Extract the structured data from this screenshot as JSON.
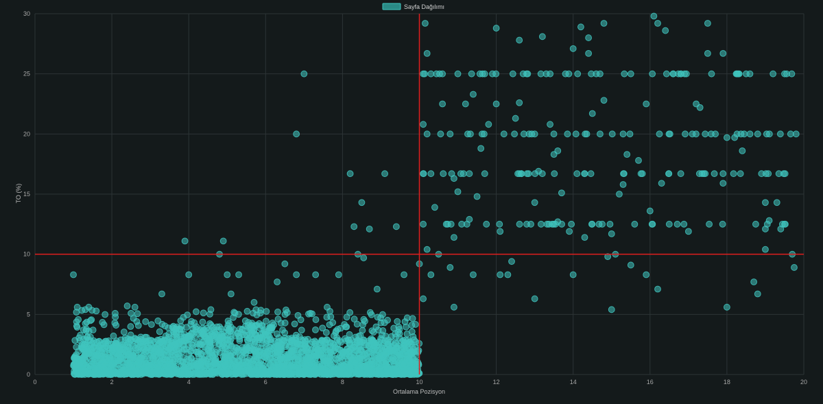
{
  "chart_data": {
    "type": "scatter",
    "title": "",
    "legend": {
      "position": "top-center",
      "label": "Sayfa Dağılımı",
      "color": "#2a8a86"
    },
    "xlabel": "Ortalama Pozisyon",
    "ylabel": "TO (%)",
    "xlim": [
      0,
      20
    ],
    "ylim": [
      0,
      30
    ],
    "x_ticks": [
      0,
      2,
      4,
      6,
      8,
      10,
      12,
      14,
      16,
      18,
      20
    ],
    "y_ticks": [
      0,
      5,
      10,
      15,
      20,
      25,
      30
    ],
    "grid": true,
    "reference_lines": {
      "x": 10,
      "y": 10,
      "color": "#e01e1e"
    },
    "point_color": "#40c4be",
    "series": [
      {
        "name": "Sayfa Dağılımı",
        "points": [
          [
            1.0,
            8.3
          ],
          [
            1.1,
            5.6
          ],
          [
            1.4,
            5.6
          ],
          [
            2.4,
            5.7
          ],
          [
            2.6,
            5.6
          ],
          [
            3.3,
            6.7
          ],
          [
            3.9,
            11.1
          ],
          [
            4.0,
            8.3
          ],
          [
            4.8,
            10.0
          ],
          [
            4.9,
            11.1
          ],
          [
            5.0,
            8.3
          ],
          [
            5.1,
            6.7
          ],
          [
            5.3,
            8.3
          ],
          [
            5.7,
            6.0
          ],
          [
            6.3,
            7.7
          ],
          [
            6.5,
            9.2
          ],
          [
            6.8,
            20.0
          ],
          [
            6.8,
            8.3
          ],
          [
            7.0,
            25.0
          ],
          [
            7.3,
            8.3
          ],
          [
            7.6,
            5.6
          ],
          [
            7.9,
            8.3
          ],
          [
            8.2,
            16.7
          ],
          [
            8.3,
            12.3
          ],
          [
            8.4,
            10.0
          ],
          [
            8.5,
            14.3
          ],
          [
            8.55,
            9.7
          ],
          [
            8.7,
            12.1
          ],
          [
            8.9,
            7.1
          ],
          [
            9.1,
            16.7
          ],
          [
            9.4,
            12.3
          ],
          [
            9.6,
            8.3
          ],
          [
            10.0,
            9.2
          ],
          [
            9.0,
            4.3
          ],
          [
            9.8,
            4.1
          ],
          [
            10.15,
            29.2
          ],
          [
            10.2,
            26.7
          ],
          [
            10.3,
            25.0
          ],
          [
            10.1,
            25.0
          ],
          [
            10.1,
            20.8
          ],
          [
            10.2,
            20.0
          ],
          [
            10.1,
            16.7
          ],
          [
            10.3,
            16.7
          ],
          [
            10.1,
            12.5
          ],
          [
            10.4,
            13.9
          ],
          [
            10.2,
            10.4
          ],
          [
            10.3,
            8.3
          ],
          [
            10.1,
            6.3
          ],
          [
            10.5,
            10.0
          ],
          [
            10.6,
            22.5
          ],
          [
            10.6,
            25.0
          ],
          [
            10.8,
            20.0
          ],
          [
            10.9,
            16.3
          ],
          [
            10.7,
            12.5
          ],
          [
            10.9,
            11.4
          ],
          [
            10.8,
            8.9
          ],
          [
            10.9,
            5.6
          ],
          [
            11.0,
            15.2
          ],
          [
            11.0,
            25.0
          ],
          [
            11.2,
            22.5
          ],
          [
            11.3,
            16.7
          ],
          [
            11.3,
            12.9
          ],
          [
            11.4,
            23.3
          ],
          [
            11.5,
            14.8
          ],
          [
            11.4,
            8.3
          ],
          [
            11.6,
            18.8
          ],
          [
            11.8,
            20.8
          ],
          [
            11.9,
            25.0
          ],
          [
            12.0,
            28.8
          ],
          [
            12.0,
            22.5
          ],
          [
            12.1,
            11.9
          ],
          [
            12.1,
            8.3
          ],
          [
            12.3,
            8.3
          ],
          [
            12.4,
            9.4
          ],
          [
            12.5,
            21.3
          ],
          [
            12.6,
            22.6
          ],
          [
            12.6,
            27.8
          ],
          [
            12.7,
            25.0
          ],
          [
            12.9,
            12.5
          ],
          [
            13.0,
            14.3
          ],
          [
            13.0,
            6.3
          ],
          [
            13.1,
            16.9
          ],
          [
            13.2,
            28.1
          ],
          [
            13.4,
            20.8
          ],
          [
            13.5,
            18.3
          ],
          [
            13.6,
            18.6
          ],
          [
            13.6,
            12.7
          ],
          [
            13.7,
            15.1
          ],
          [
            13.9,
            11.9
          ],
          [
            14.0,
            27.1
          ],
          [
            14.1,
            16.7
          ],
          [
            14.2,
            28.9
          ],
          [
            14.3,
            11.4
          ],
          [
            14.4,
            26.7
          ],
          [
            14.4,
            28.0
          ],
          [
            14.5,
            21.7
          ],
          [
            14.6,
            25.0
          ],
          [
            14.7,
            20.0
          ],
          [
            14.8,
            29.2
          ],
          [
            14.8,
            22.8
          ],
          [
            14.9,
            9.8
          ],
          [
            15.0,
            11.7
          ],
          [
            15.0,
            5.4
          ],
          [
            15.2,
            15.0
          ],
          [
            15.3,
            15.8
          ],
          [
            15.4,
            18.3
          ],
          [
            15.5,
            9.1
          ],
          [
            15.6,
            12.5
          ],
          [
            15.7,
            17.8
          ],
          [
            15.8,
            16.7
          ],
          [
            15.9,
            8.3
          ],
          [
            15.9,
            22.5
          ],
          [
            16.0,
            13.6
          ],
          [
            16.1,
            29.8
          ],
          [
            16.2,
            29.2
          ],
          [
            16.2,
            7.1
          ],
          [
            16.3,
            15.9
          ],
          [
            16.4,
            28.6
          ],
          [
            16.6,
            25.0
          ],
          [
            16.8,
            16.7
          ],
          [
            16.9,
            25.0
          ],
          [
            17.0,
            11.9
          ],
          [
            17.1,
            20.0
          ],
          [
            17.2,
            22.5
          ],
          [
            17.3,
            22.2
          ],
          [
            17.4,
            16.7
          ],
          [
            17.5,
            26.7
          ],
          [
            17.5,
            29.2
          ],
          [
            17.6,
            25.0
          ],
          [
            17.7,
            20.0
          ],
          [
            17.9,
            26.7
          ],
          [
            17.9,
            15.9
          ],
          [
            18.0,
            19.7
          ],
          [
            18.0,
            5.6
          ],
          [
            18.2,
            19.7
          ],
          [
            18.3,
            25.0
          ],
          [
            18.4,
            18.6
          ],
          [
            18.5,
            25.0
          ],
          [
            18.6,
            20.0
          ],
          [
            18.7,
            7.7
          ],
          [
            18.8,
            6.7
          ],
          [
            18.8,
            20.0
          ],
          [
            18.9,
            16.7
          ],
          [
            19.0,
            12.1
          ],
          [
            19.0,
            14.3
          ],
          [
            19.0,
            10.4
          ],
          [
            19.1,
            12.8
          ],
          [
            19.2,
            25.0
          ],
          [
            19.3,
            14.3
          ],
          [
            19.4,
            12.1
          ],
          [
            19.5,
            25.0
          ],
          [
            19.5,
            12.5
          ],
          [
            19.7,
            10.0
          ],
          [
            19.75,
            8.9
          ],
          [
            19.8,
            20.0
          ],
          [
            16.5,
            12.5
          ],
          [
            15.3,
            20.0
          ],
          [
            13.0,
            20.0
          ],
          [
            12.8,
            16.7
          ],
          [
            14.7,
            25.0
          ],
          [
            15.1,
            10.0
          ],
          [
            17.9,
            16.7
          ],
          [
            11.7,
            16.7
          ],
          [
            13.3,
            25.0
          ],
          [
            14.0,
            8.3
          ],
          [
            12.6,
            16.7
          ],
          [
            16.8,
            25.0
          ],
          [
            11.1,
            12.5
          ],
          [
            14.3,
            16.7
          ],
          [
            15.5,
            25.0
          ],
          [
            13.8,
            25.0
          ],
          [
            12.2,
            20.0
          ]
        ]
      }
    ]
  }
}
